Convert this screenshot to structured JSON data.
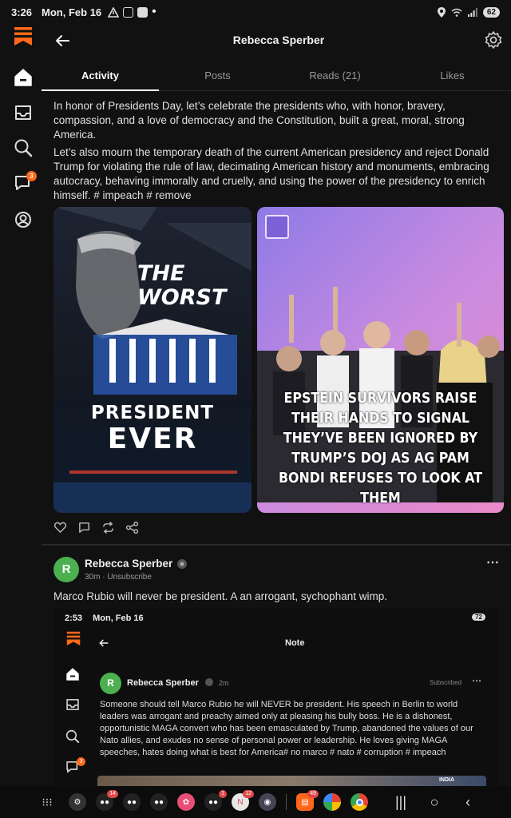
{
  "status_bar": {
    "time": "3:26",
    "date": "Mon, Feb 16",
    "battery": "62"
  },
  "rail": {
    "chat_badge": "3"
  },
  "header": {
    "title": "Rebecca Sperber"
  },
  "tabs": [
    {
      "label": "Activity",
      "active": true
    },
    {
      "label": "Posts",
      "active": false
    },
    {
      "label": "Reads (21)",
      "active": false
    },
    {
      "label": "Likes",
      "active": false
    }
  ],
  "post1": {
    "paragraph1": "In honor of Presidents Day, let’s celebrate the presidents who, with honor, bravery, compassion, and a love of democracy and the Constitution, built a great, moral, strong America.",
    "paragraph2": "Let’s also mourn the temporary death of the current American presidency and reject Donald Trump for violating the rule of law, decimating American history and monuments, embracing autocracy, behaving immorally and cruelly, and using the power of the presidency to enrich himself. # impeach # remove",
    "image1": {
      "line1": "THE",
      "line2": "WORST",
      "line3": "PRESIDENT",
      "line4": "EVER"
    },
    "image2": {
      "caption": "EPSTEIN SURVIVORS RAISE THEIR HANDS TO SIGNAL THEY’VE BEEN IGNORED BY TRUMP’S DOJ AS AG PAM BONDI REFUSES TO LOOK AT THEM"
    }
  },
  "post2": {
    "avatar_letter": "R",
    "author": "Rebecca Sperber",
    "time": "30m",
    "unsubscribe": "Unsubscribe",
    "text": "Marco Rubio will never be president. A an arrogant, sychophant wimp."
  },
  "embed": {
    "time": "2:53",
    "date": "Mon, Feb 16",
    "battery": "72",
    "title": "Note",
    "chat_badge": "3",
    "avatar_letter": "R",
    "author": "Rebecca Sperber",
    "age": "2m",
    "subscribed": "Subscribed",
    "text": "Someone should tell Marco Rubio he will NEVER be president. His speech in Berlin to world leaders was arrogant and preachy aimed only at pleasing his bully boss. He is a dishonest, opportunistic MAGA convert who has been emasculated by Trump, abandoned the values of our Nato allies, and exudes no sense of personal power or leadership. He loves giving MAGA speeches, hates doing what is best for America# no marco # nato # corruption # impeach",
    "image_tag": "INDIA"
  },
  "navbar": {
    "badges": {
      "app1": "14",
      "app5": "1",
      "app6": "12",
      "substack": "49"
    }
  },
  "colors": {
    "accent": "#ff6719",
    "background": "#111111",
    "avatar": "#4caf50"
  }
}
